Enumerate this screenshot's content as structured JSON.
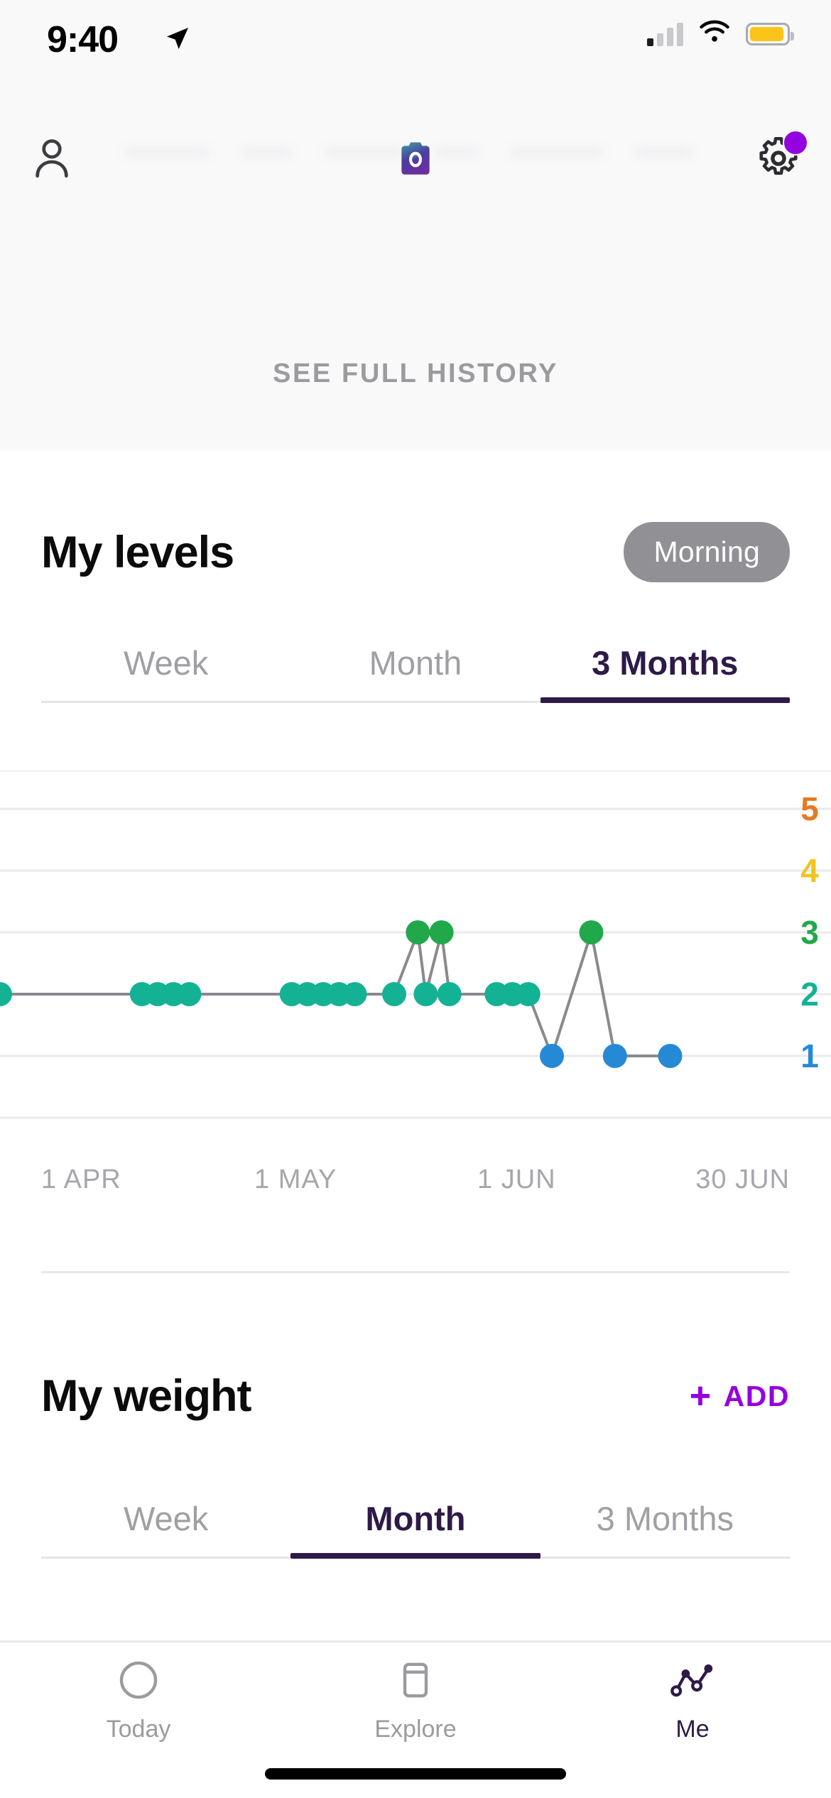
{
  "status_bar": {
    "time": "9:40",
    "location_icon": "location-arrow-icon",
    "signal_icon": "cellular-signal-icon",
    "wifi_icon": "wifi-icon",
    "battery_icon": "battery-icon",
    "battery_color": "#fcc419"
  },
  "header": {
    "profile_icon": "person-icon",
    "camera_icon": "camera-icon",
    "settings_icon": "gear-icon",
    "notification_dot_color": "#9400e0",
    "see_full_history": "SEE FULL HISTORY"
  },
  "levels_section": {
    "title": "My levels",
    "pill_label": "Morning",
    "pill_color": "#919195",
    "tabs": [
      {
        "label": "Week",
        "active": false
      },
      {
        "label": "Month",
        "active": false
      },
      {
        "label": "3 Months",
        "active": true
      }
    ]
  },
  "weight_section": {
    "title": "My weight",
    "add_label": "ADD",
    "add_icon": "plus-icon",
    "add_color": "#9400e0",
    "tabs": [
      {
        "label": "Week",
        "active": false
      },
      {
        "label": "Month",
        "active": true
      },
      {
        "label": "3 Months",
        "active": false
      }
    ]
  },
  "chart_data": {
    "type": "line",
    "title": "My levels",
    "xlabel": "",
    "ylabel": "",
    "ylim": [
      0,
      6
    ],
    "grid": true,
    "legend": "none",
    "y_ticks": [
      {
        "value": 5,
        "label": "5",
        "color": "#e8791f"
      },
      {
        "value": 4,
        "label": "4",
        "color": "#f2c41c"
      },
      {
        "value": 3,
        "label": "3",
        "color": "#21a84b"
      },
      {
        "value": 2,
        "label": "2",
        "color": "#14b294"
      },
      {
        "value": 1,
        "label": "1",
        "color": "#2589d6"
      }
    ],
    "x_ticks": [
      "1 APR",
      "1 MAY",
      "1 JUN",
      "30 JUN"
    ],
    "x_range": [
      "1 APR",
      "30 JUN"
    ],
    "level_colors": {
      "1": "#2589d6",
      "2": "#14b294",
      "3": "#21a84b",
      "4": "#f2c41c",
      "5": "#e8791f"
    },
    "line_color": "#8a8a8e",
    "points": [
      {
        "x": 0,
        "y": 2
      },
      {
        "x": 18,
        "y": 2
      },
      {
        "x": 20,
        "y": 2
      },
      {
        "x": 22,
        "y": 2
      },
      {
        "x": 24,
        "y": 2
      },
      {
        "x": 37,
        "y": 2
      },
      {
        "x": 39,
        "y": 2
      },
      {
        "x": 41,
        "y": 2
      },
      {
        "x": 43,
        "y": 2
      },
      {
        "x": 45,
        "y": 2
      },
      {
        "x": 50,
        "y": 2
      },
      {
        "x": 53,
        "y": 3
      },
      {
        "x": 54,
        "y": 2
      },
      {
        "x": 56,
        "y": 3
      },
      {
        "x": 57,
        "y": 2
      },
      {
        "x": 63,
        "y": 2
      },
      {
        "x": 65,
        "y": 2
      },
      {
        "x": 67,
        "y": 2
      },
      {
        "x": 70,
        "y": 1
      },
      {
        "x": 75,
        "y": 3
      },
      {
        "x": 78,
        "y": 1
      },
      {
        "x": 85,
        "y": 1
      }
    ]
  },
  "bottom_nav": [
    {
      "label": "Today",
      "icon": "circle-icon",
      "active": false
    },
    {
      "label": "Explore",
      "icon": "card-icon",
      "active": false
    },
    {
      "label": "Me",
      "icon": "line-chart-icon",
      "active": true
    }
  ]
}
